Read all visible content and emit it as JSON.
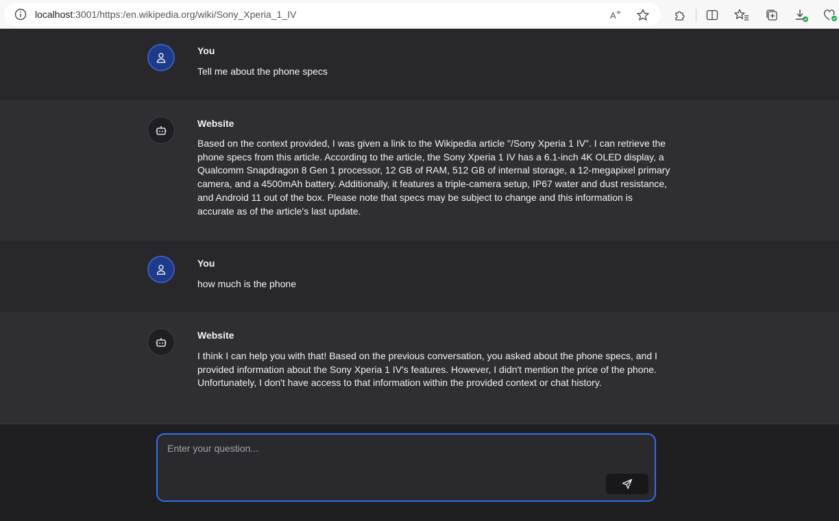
{
  "browser": {
    "url_host": "localhost",
    "url_rest": ":3001/https:/en.wikipedia.org/wiki/Sony_Xperia_1_IV",
    "icons": [
      "info-icon",
      "read-aloud-icon",
      "favorite-star-icon",
      "extensions-icon",
      "split-screen-icon",
      "favorites-icon",
      "collections-icon",
      "downloads-icon",
      "performance-icon"
    ]
  },
  "messages": [
    {
      "role": "user",
      "author": "You",
      "text": "Tell me about the phone specs"
    },
    {
      "role": "bot",
      "author": "Website",
      "text": "Based on the context provided, I was given a link to the Wikipedia article \"/Sony Xperia 1 IV\". I can retrieve the phone specs from this article. According to the article, the Sony Xperia 1 IV has a 6.1-inch 4K OLED display, a Qualcomm Snapdragon 8 Gen 1 processor, 12 GB of RAM, 512 GB of internal storage, a 12-megapixel primary camera, and a 4500mAh battery. Additionally, it features a triple-camera setup, IP67 water and dust resistance, and Android 11 out of the box. Please note that specs may be subject to change and this information is accurate as of the article's last update."
    },
    {
      "role": "user",
      "author": "You",
      "text": "how much is the phone"
    },
    {
      "role": "bot",
      "author": "Website",
      "text": "I think I can help you with that! Based on the previous conversation, you asked about the phone specs, and I provided information about the Sony Xperia 1 IV's features. However, I didn't mention the price of the phone. Unfortunately, I don't have access to that information within the provided context or chat history."
    }
  ],
  "composer": {
    "placeholder": "Enter your question...",
    "value": "",
    "send_icon": "send-icon"
  },
  "colors": {
    "accent": "#2f6fed",
    "user_avatar": "#1e3a8a",
    "background": "#28282c"
  }
}
